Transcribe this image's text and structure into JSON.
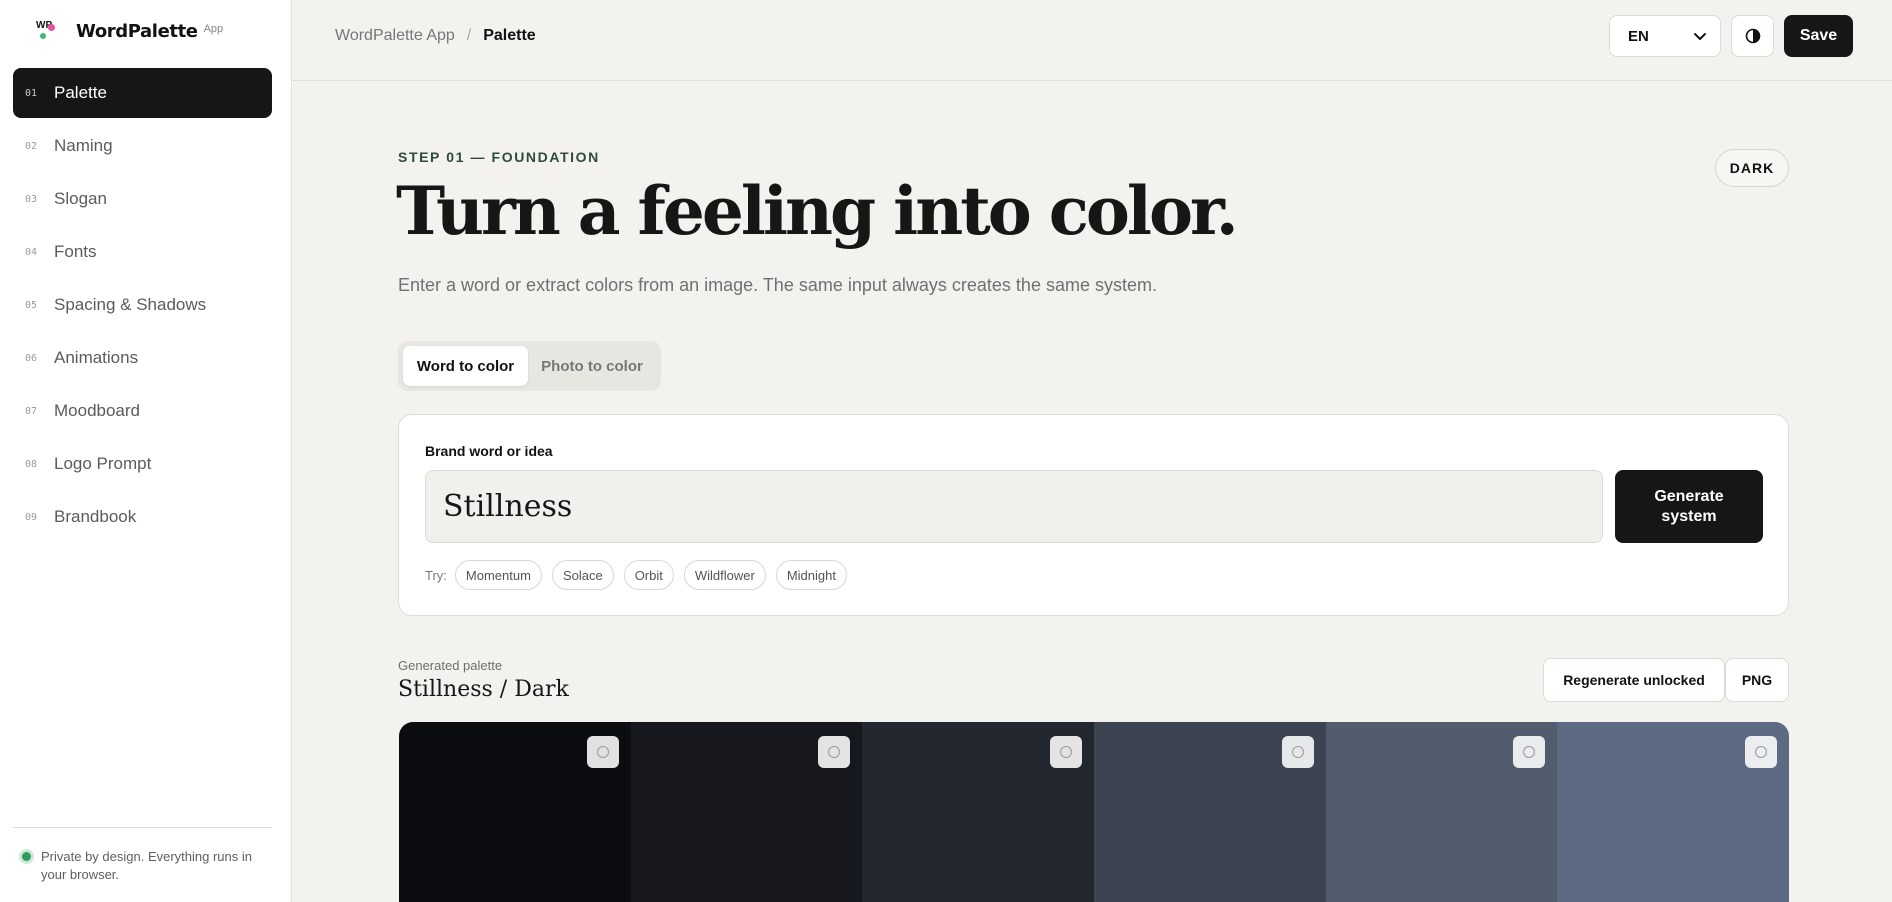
{
  "app": {
    "brand_name": "WordPalette",
    "brand_suffix": "App",
    "logo_letters": "WP"
  },
  "sidebar": {
    "items": [
      {
        "num": "01",
        "label": "Palette",
        "active": true
      },
      {
        "num": "02",
        "label": "Naming"
      },
      {
        "num": "03",
        "label": "Slogan"
      },
      {
        "num": "04",
        "label": "Fonts"
      },
      {
        "num": "05",
        "label": "Spacing & Shadows"
      },
      {
        "num": "06",
        "label": "Animations"
      },
      {
        "num": "07",
        "label": "Moodboard"
      },
      {
        "num": "08",
        "label": "Logo Prompt"
      },
      {
        "num": "09",
        "label": "Brandbook"
      }
    ],
    "footer_text": "Private by design. Everything runs in your browser."
  },
  "topbar": {
    "breadcrumb_root": "WordPalette App",
    "breadcrumb_sep": "/",
    "breadcrumb_current": "Palette",
    "language": "EN",
    "save_label": "Save"
  },
  "main": {
    "eyebrow": "STEP 01 — FOUNDATION",
    "mode_badge": "DARK",
    "headline": "Turn a feeling into color.",
    "subtitle": "Enter a word or extract colors from an image. The same input always creates the same system.",
    "tabs": [
      {
        "label": "Word to color",
        "active": true
      },
      {
        "label": "Photo to color"
      }
    ],
    "input": {
      "label": "Brand word or idea",
      "value": "Stillness",
      "generate_label": "Generate system",
      "try_label": "Try:",
      "suggestions": [
        "Momentum",
        "Solace",
        "Orbit",
        "Wildflower",
        "Midnight"
      ]
    },
    "palette": {
      "section_label": "Generated palette",
      "title": "Stillness / Dark",
      "regenerate_label": "Regenerate unlocked",
      "png_label": "PNG",
      "swatches": [
        "#0c0d10",
        "#16181d",
        "#22272f",
        "#3c4452",
        "#535c6d",
        "#5d6a83"
      ]
    }
  }
}
